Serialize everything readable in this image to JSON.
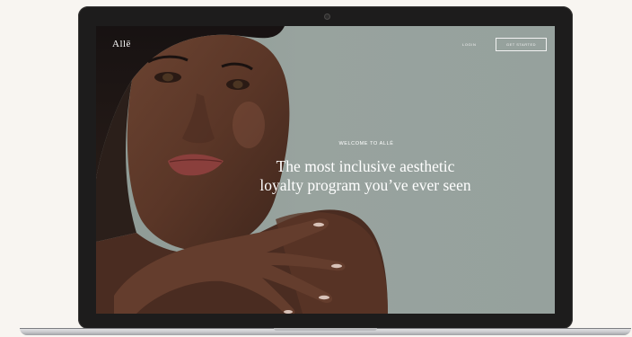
{
  "brand": {
    "logo": "Allē"
  },
  "nav": {
    "login_label": "LOGIN",
    "cta_label": "GET STARTED"
  },
  "hero": {
    "eyebrow": "WELCOME TO ALLĒ",
    "title_line1": "The most inclusive aesthetic",
    "title_line2": "loyalty program you’ve ever seen"
  },
  "colors": {
    "page_background": "#f8f5f1",
    "hero_background": "#96a19d",
    "laptop_bezel": "#1d1c1c",
    "text": "#ffffff"
  }
}
